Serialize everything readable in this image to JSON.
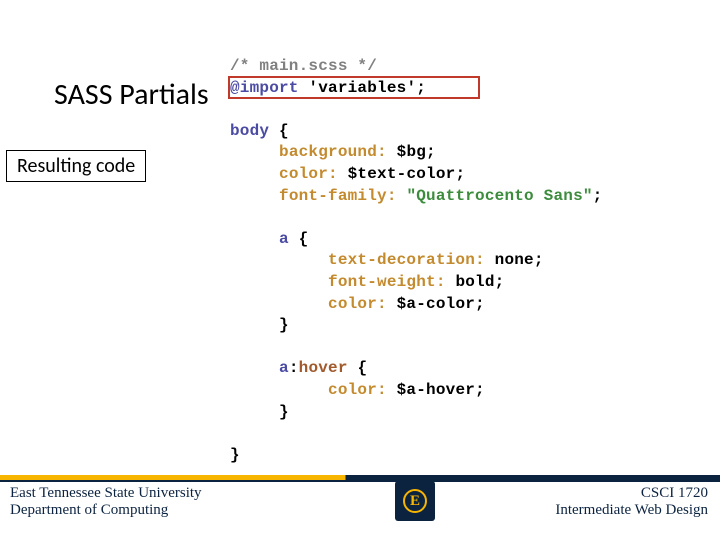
{
  "title": "SASS Partials",
  "label": "Resulting code",
  "code": {
    "line1_comment": "/* main.scss */",
    "line2_import": "@import",
    "line2_str": " 'variables';",
    "body_sel": "body ",
    "brace_open": "{",
    "bg_prop": "background:",
    "bg_val": " $bg;",
    "color_prop": "color:",
    "color_val": " $text-color;",
    "ff_prop": "font-family:",
    "ff_val": " \"Quattrocento Sans\"",
    "semi": ";",
    "a_sel": "a ",
    "td_prop": "text-decoration:",
    "td_val": " none;",
    "fw_prop": "font-weight:",
    "fw_val": " bold;",
    "acolor_prop": "color:",
    "acolor_val": " $a-color;",
    "brace_close": "}",
    "ahover_sel_a": "a",
    "ahover_sel_colon": ":",
    "ahover_sel_hover": "hover ",
    "ahcolor_prop": "color:",
    "ahcolor_val": " $a-hover;"
  },
  "footer": {
    "uni_line1": "East Tennessee State University",
    "uni_line2": "Department of Computing",
    "course_line1": "CSCI 1720",
    "course_line2": "Intermediate Web Design",
    "logo_letter": "E"
  }
}
